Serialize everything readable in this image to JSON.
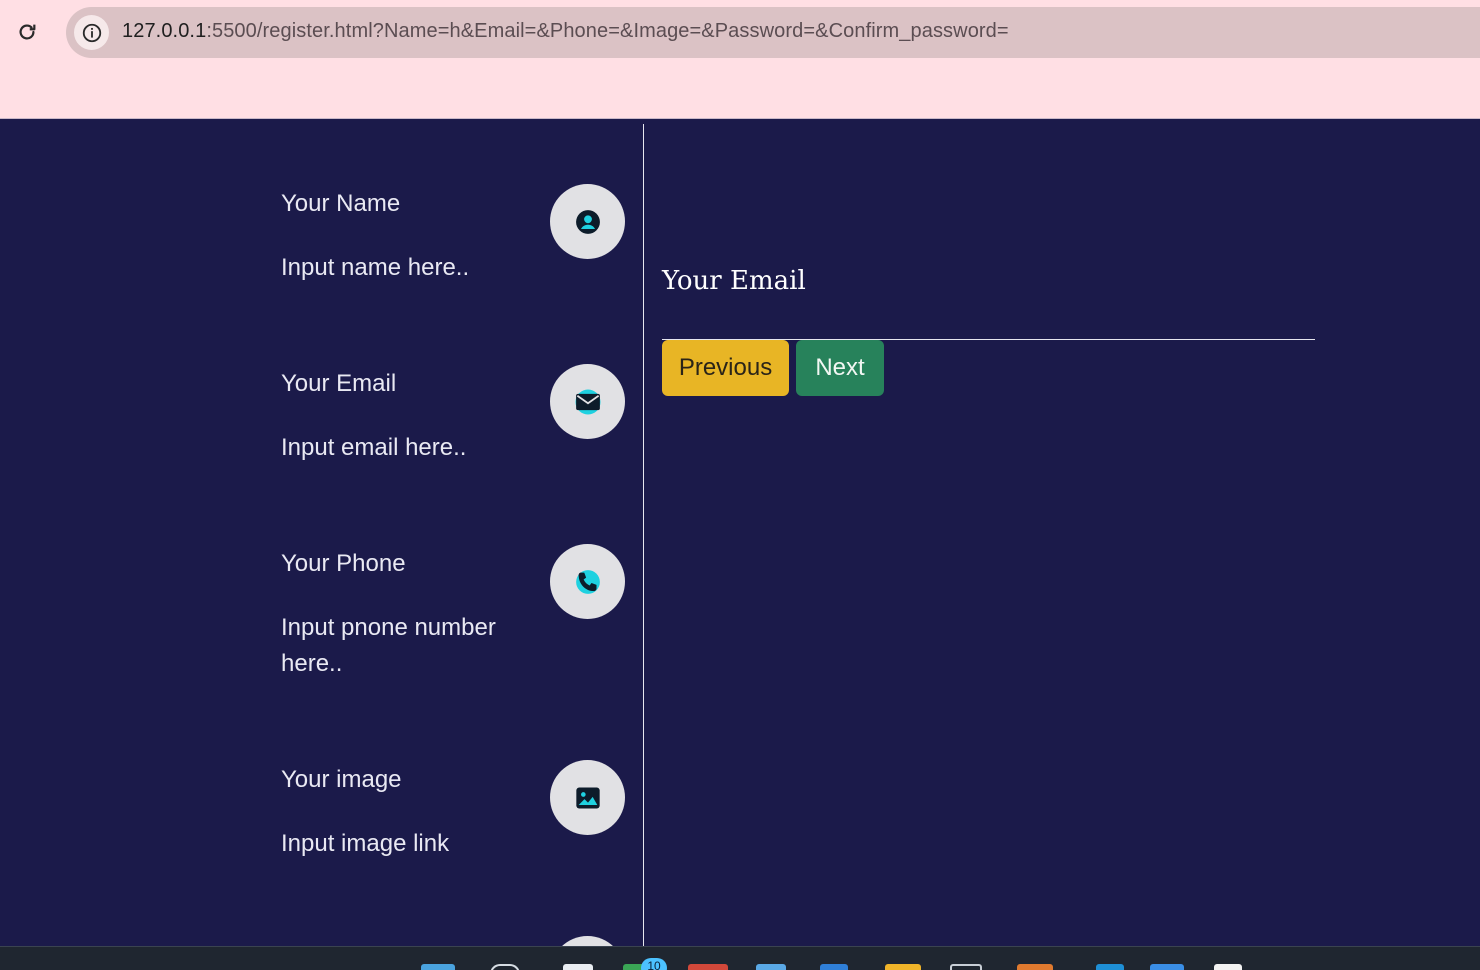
{
  "browser": {
    "url_host": "127.0.0.1",
    "url_rest": ":5500/register.html?Name=h&Email=&Phone=&Image=&Password=&Confirm_password="
  },
  "steps": [
    {
      "title": "Your Name",
      "description": "Input name here..",
      "icon": "user-circle-icon"
    },
    {
      "title": "Your Email",
      "description": "Input email here..",
      "icon": "envelope-icon"
    },
    {
      "title": "Your Phone",
      "description": "Input pnone number here..",
      "icon": "phone-icon"
    },
    {
      "title": "Your image",
      "description": "Input image link",
      "icon": "image-icon"
    }
  ],
  "form": {
    "field_label": "Your Email",
    "field_value": "",
    "previous_label": "Previous",
    "next_label": "Next"
  },
  "taskbar": {
    "badge_count": "10"
  },
  "colors": {
    "page_background": "#1b1a4a",
    "previous_button": "#e8b525",
    "next_button": "#27825b",
    "icon_circle": "#e1e1e4",
    "icon_accent": "#1fd1e0"
  }
}
